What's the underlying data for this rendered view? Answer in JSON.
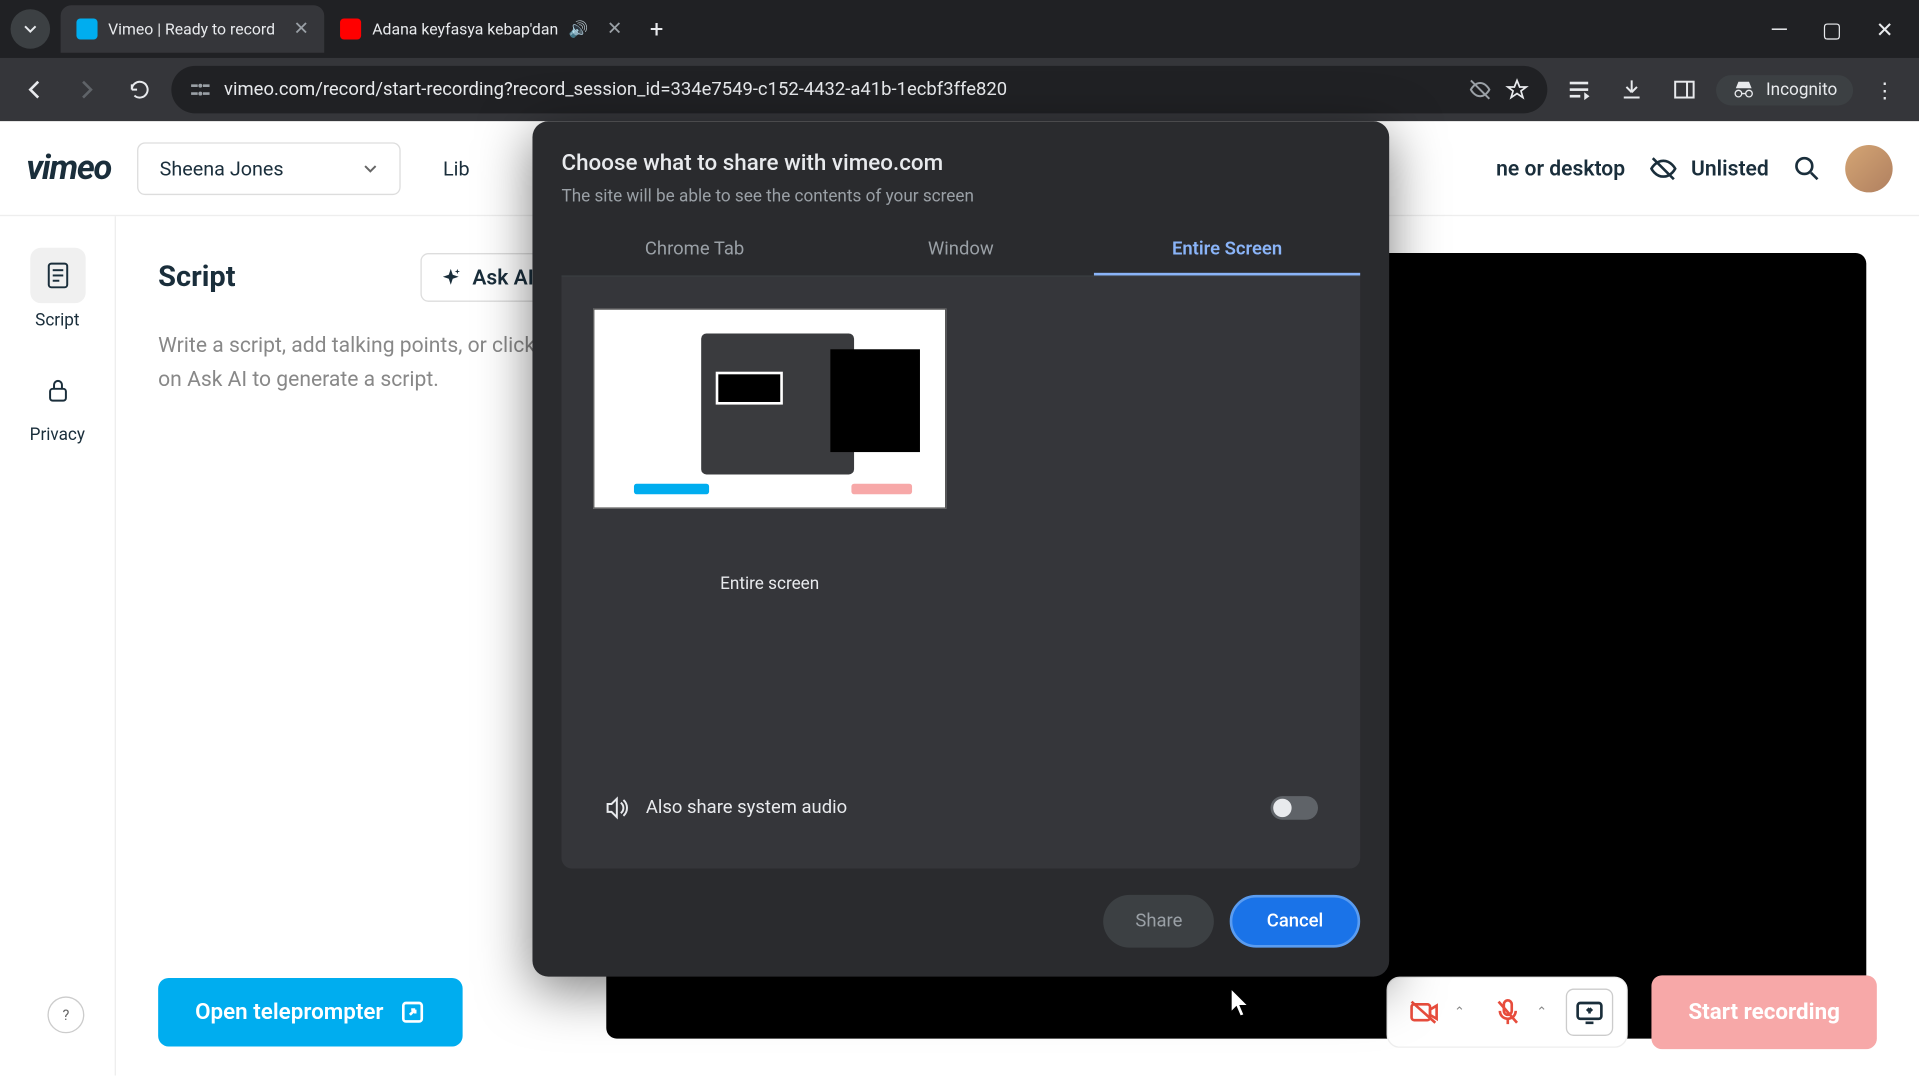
{
  "browser": {
    "tabs": [
      {
        "title": "Vimeo | Ready to record",
        "active": true
      },
      {
        "title": "Adana keyfasya kebap'dan",
        "active": false,
        "audio": true
      }
    ],
    "url": "vimeo.com/record/start-recording?record_session_id=334e7549-c152-4432-a41b-1ecbf3ffe820",
    "incognito_label": "Incognito"
  },
  "vimeo": {
    "logo": "vimeo",
    "user_name": "Sheena Jones",
    "library_label": "Lib",
    "header_right_text": "ne or desktop",
    "unlisted_label": "Unlisted",
    "sidebar": {
      "script": "Script",
      "privacy": "Privacy"
    },
    "script": {
      "title": "Script",
      "ask_ai": "Ask AI",
      "placeholder": "Write a script, add talking points, or click on Ask AI to generate a script."
    },
    "teleprompter_btn": "Open teleprompter",
    "start_btn": "Start recording"
  },
  "dialog": {
    "title": "Choose what to share with vimeo.com",
    "subtitle": "The site will be able to see the contents of your screen",
    "tabs": {
      "chrome": "Chrome Tab",
      "window": "Window",
      "entire": "Entire Screen"
    },
    "thumb_label": "Entire screen",
    "audio_label": "Also share system audio",
    "share": "Share",
    "cancel": "Cancel"
  }
}
